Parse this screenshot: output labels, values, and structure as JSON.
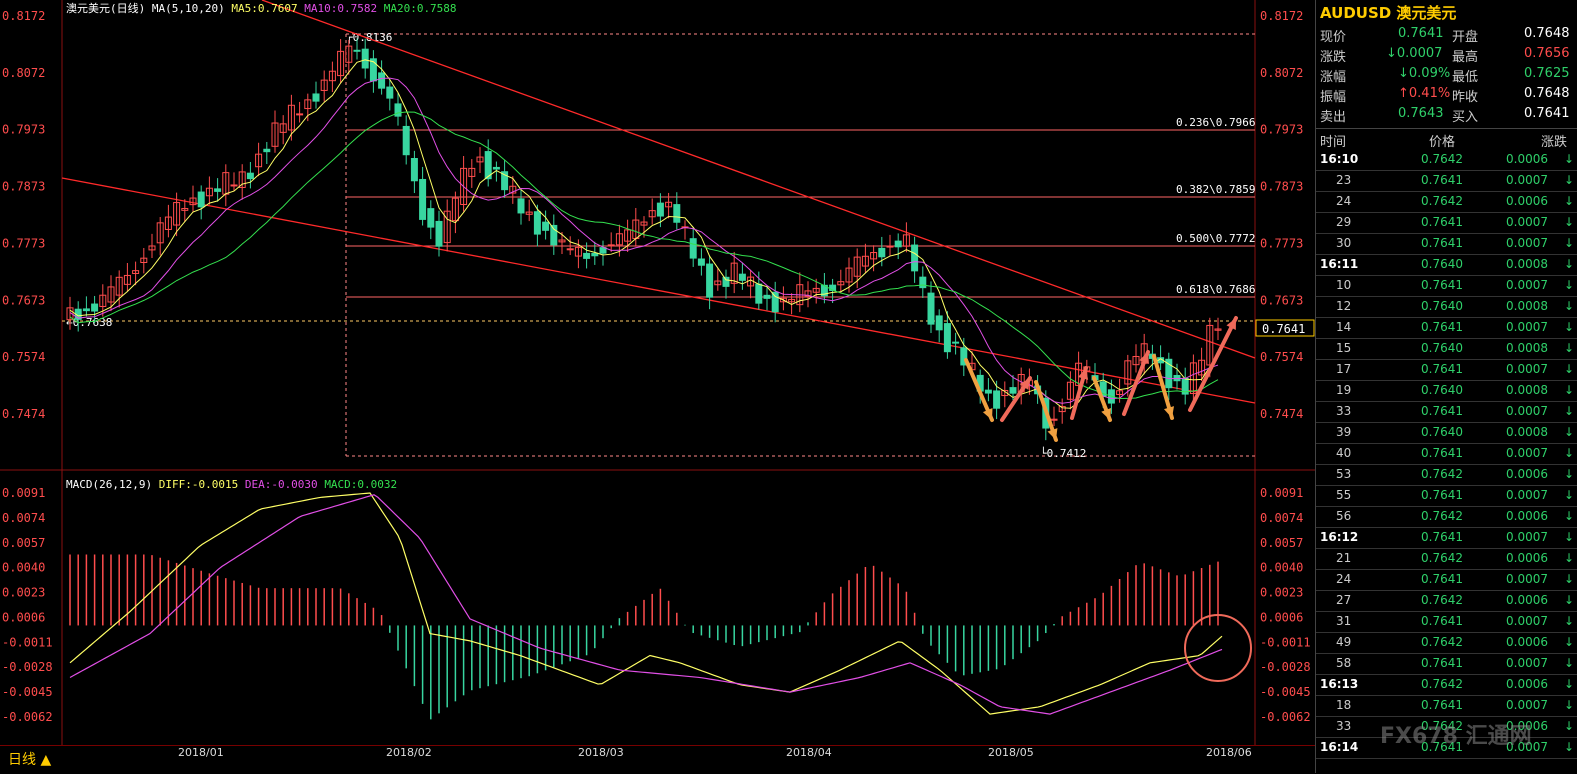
{
  "chart_header": {
    "name": "澳元美元(日线)",
    "ma_label": "MA(5,10,20)",
    "ma5": "MA5:0.7607",
    "ma10": "MA10:0.7582",
    "ma20": "MA20:0.7588"
  },
  "macd_header": {
    "name": "MACD(26,12,9)",
    "diff": "DIFF:-0.0015",
    "dea": "DEA:-0.0030",
    "macd": "MACD:0.0032"
  },
  "colors": {
    "up": "#ff4d4d",
    "down": "#38d6a0",
    "ma5": "#ffff66",
    "ma10": "#e14fe6",
    "ma20": "#34e04f",
    "trend": "#ff2a2a"
  },
  "price_axis": [
    "0.8172",
    "0.8072",
    "0.7973",
    "0.7873",
    "0.7773",
    "0.7673",
    "0.7574",
    "0.7474"
  ],
  "macd_axis": [
    "0.0091",
    "0.0074",
    "0.0057",
    "0.0040",
    "0.0023",
    "0.0006",
    "-0.0011",
    "-0.0028",
    "-0.0045",
    "-0.0062"
  ],
  "date_axis": [
    "2018/01",
    "2018/02",
    "2018/03",
    "2018/04",
    "2018/05",
    "2018/06"
  ],
  "fib_levels": [
    "0.236\\0.7966",
    "0.382\\0.7859",
    "0.500\\0.7772",
    "0.618\\0.7686"
  ],
  "annotations": {
    "high": "0.8136",
    "low": "0.7412",
    "left_price": "0.7638",
    "current": "0.7641"
  },
  "period_button": "日线",
  "panel": {
    "title": "AUDUSD 澳元美元",
    "quotes": [
      {
        "l1": "现价",
        "v1": "0.7641",
        "l2": "开盘",
        "v2": "0.7648"
      },
      {
        "l1": "涨跌",
        "v1": "↓0.0007",
        "l2": "最高",
        "v2": "0.7656"
      },
      {
        "l1": "涨幅",
        "v1": "↓0.09%",
        "l2": "最低",
        "v2": "0.7625"
      },
      {
        "l1": "振幅",
        "v1": "↑0.41%",
        "l2": "昨收",
        "v2": "0.7648"
      },
      {
        "l1": "卖出",
        "v1": "0.7643",
        "l2": "买入",
        "v2": "0.7641"
      }
    ],
    "tick_header": {
      "time": "时间",
      "price": "价格",
      "change": "涨跌"
    },
    "ticks": [
      {
        "t": "16:10",
        "p": "0.7642",
        "c": "0.0006"
      },
      {
        "t": "23",
        "p": "0.7641",
        "c": "0.0007"
      },
      {
        "t": "24",
        "p": "0.7642",
        "c": "0.0006"
      },
      {
        "t": "29",
        "p": "0.7641",
        "c": "0.0007"
      },
      {
        "t": "30",
        "p": "0.7641",
        "c": "0.0007"
      },
      {
        "t": "16:11",
        "p": "0.7640",
        "c": "0.0008"
      },
      {
        "t": "10",
        "p": "0.7641",
        "c": "0.0007"
      },
      {
        "t": "12",
        "p": "0.7640",
        "c": "0.0008"
      },
      {
        "t": "14",
        "p": "0.7641",
        "c": "0.0007"
      },
      {
        "t": "15",
        "p": "0.7640",
        "c": "0.0008"
      },
      {
        "t": "17",
        "p": "0.7641",
        "c": "0.0007"
      },
      {
        "t": "19",
        "p": "0.7640",
        "c": "0.0008"
      },
      {
        "t": "33",
        "p": "0.7641",
        "c": "0.0007"
      },
      {
        "t": "39",
        "p": "0.7640",
        "c": "0.0008"
      },
      {
        "t": "40",
        "p": "0.7641",
        "c": "0.0007"
      },
      {
        "t": "53",
        "p": "0.7642",
        "c": "0.0006"
      },
      {
        "t": "55",
        "p": "0.7641",
        "c": "0.0007"
      },
      {
        "t": "56",
        "p": "0.7642",
        "c": "0.0006"
      },
      {
        "t": "16:12",
        "p": "0.7641",
        "c": "0.0007"
      },
      {
        "t": "21",
        "p": "0.7642",
        "c": "0.0006"
      },
      {
        "t": "24",
        "p": "0.7641",
        "c": "0.0007"
      },
      {
        "t": "27",
        "p": "0.7642",
        "c": "0.0006"
      },
      {
        "t": "31",
        "p": "0.7641",
        "c": "0.0007"
      },
      {
        "t": "49",
        "p": "0.7642",
        "c": "0.0006"
      },
      {
        "t": "58",
        "p": "0.7641",
        "c": "0.0007"
      },
      {
        "t": "16:13",
        "p": "0.7642",
        "c": "0.0006"
      },
      {
        "t": "18",
        "p": "0.7641",
        "c": "0.0007"
      },
      {
        "t": "33",
        "p": "0.7642",
        "c": "0.0006"
      },
      {
        "t": "16:14",
        "p": "0.7641",
        "c": "0.0007"
      }
    ]
  },
  "logo": "FX678 汇通网",
  "chart_data": {
    "type": "candlestick",
    "title": "澳元美元(日线)",
    "x_range": [
      "2017/12",
      "2018/06"
    ],
    "y_range": [
      0.7412,
      0.8172
    ],
    "swing_high": 0.8136,
    "swing_low": 0.7412,
    "last_close": 0.7641,
    "moving_averages": {
      "MA5": 0.7607,
      "MA10": 0.7582,
      "MA20": 0.7588
    },
    "fibonacci": [
      {
        "ratio": 0.236,
        "value": 0.7966
      },
      {
        "ratio": 0.382,
        "value": 0.7859
      },
      {
        "ratio": 0.5,
        "value": 0.7772
      },
      {
        "ratio": 0.618,
        "value": 0.7686
      }
    ],
    "macd": {
      "params": "26,12,9",
      "DIFF": -0.0015,
      "DEA": -0.003,
      "MACD": 0.0032
    }
  }
}
